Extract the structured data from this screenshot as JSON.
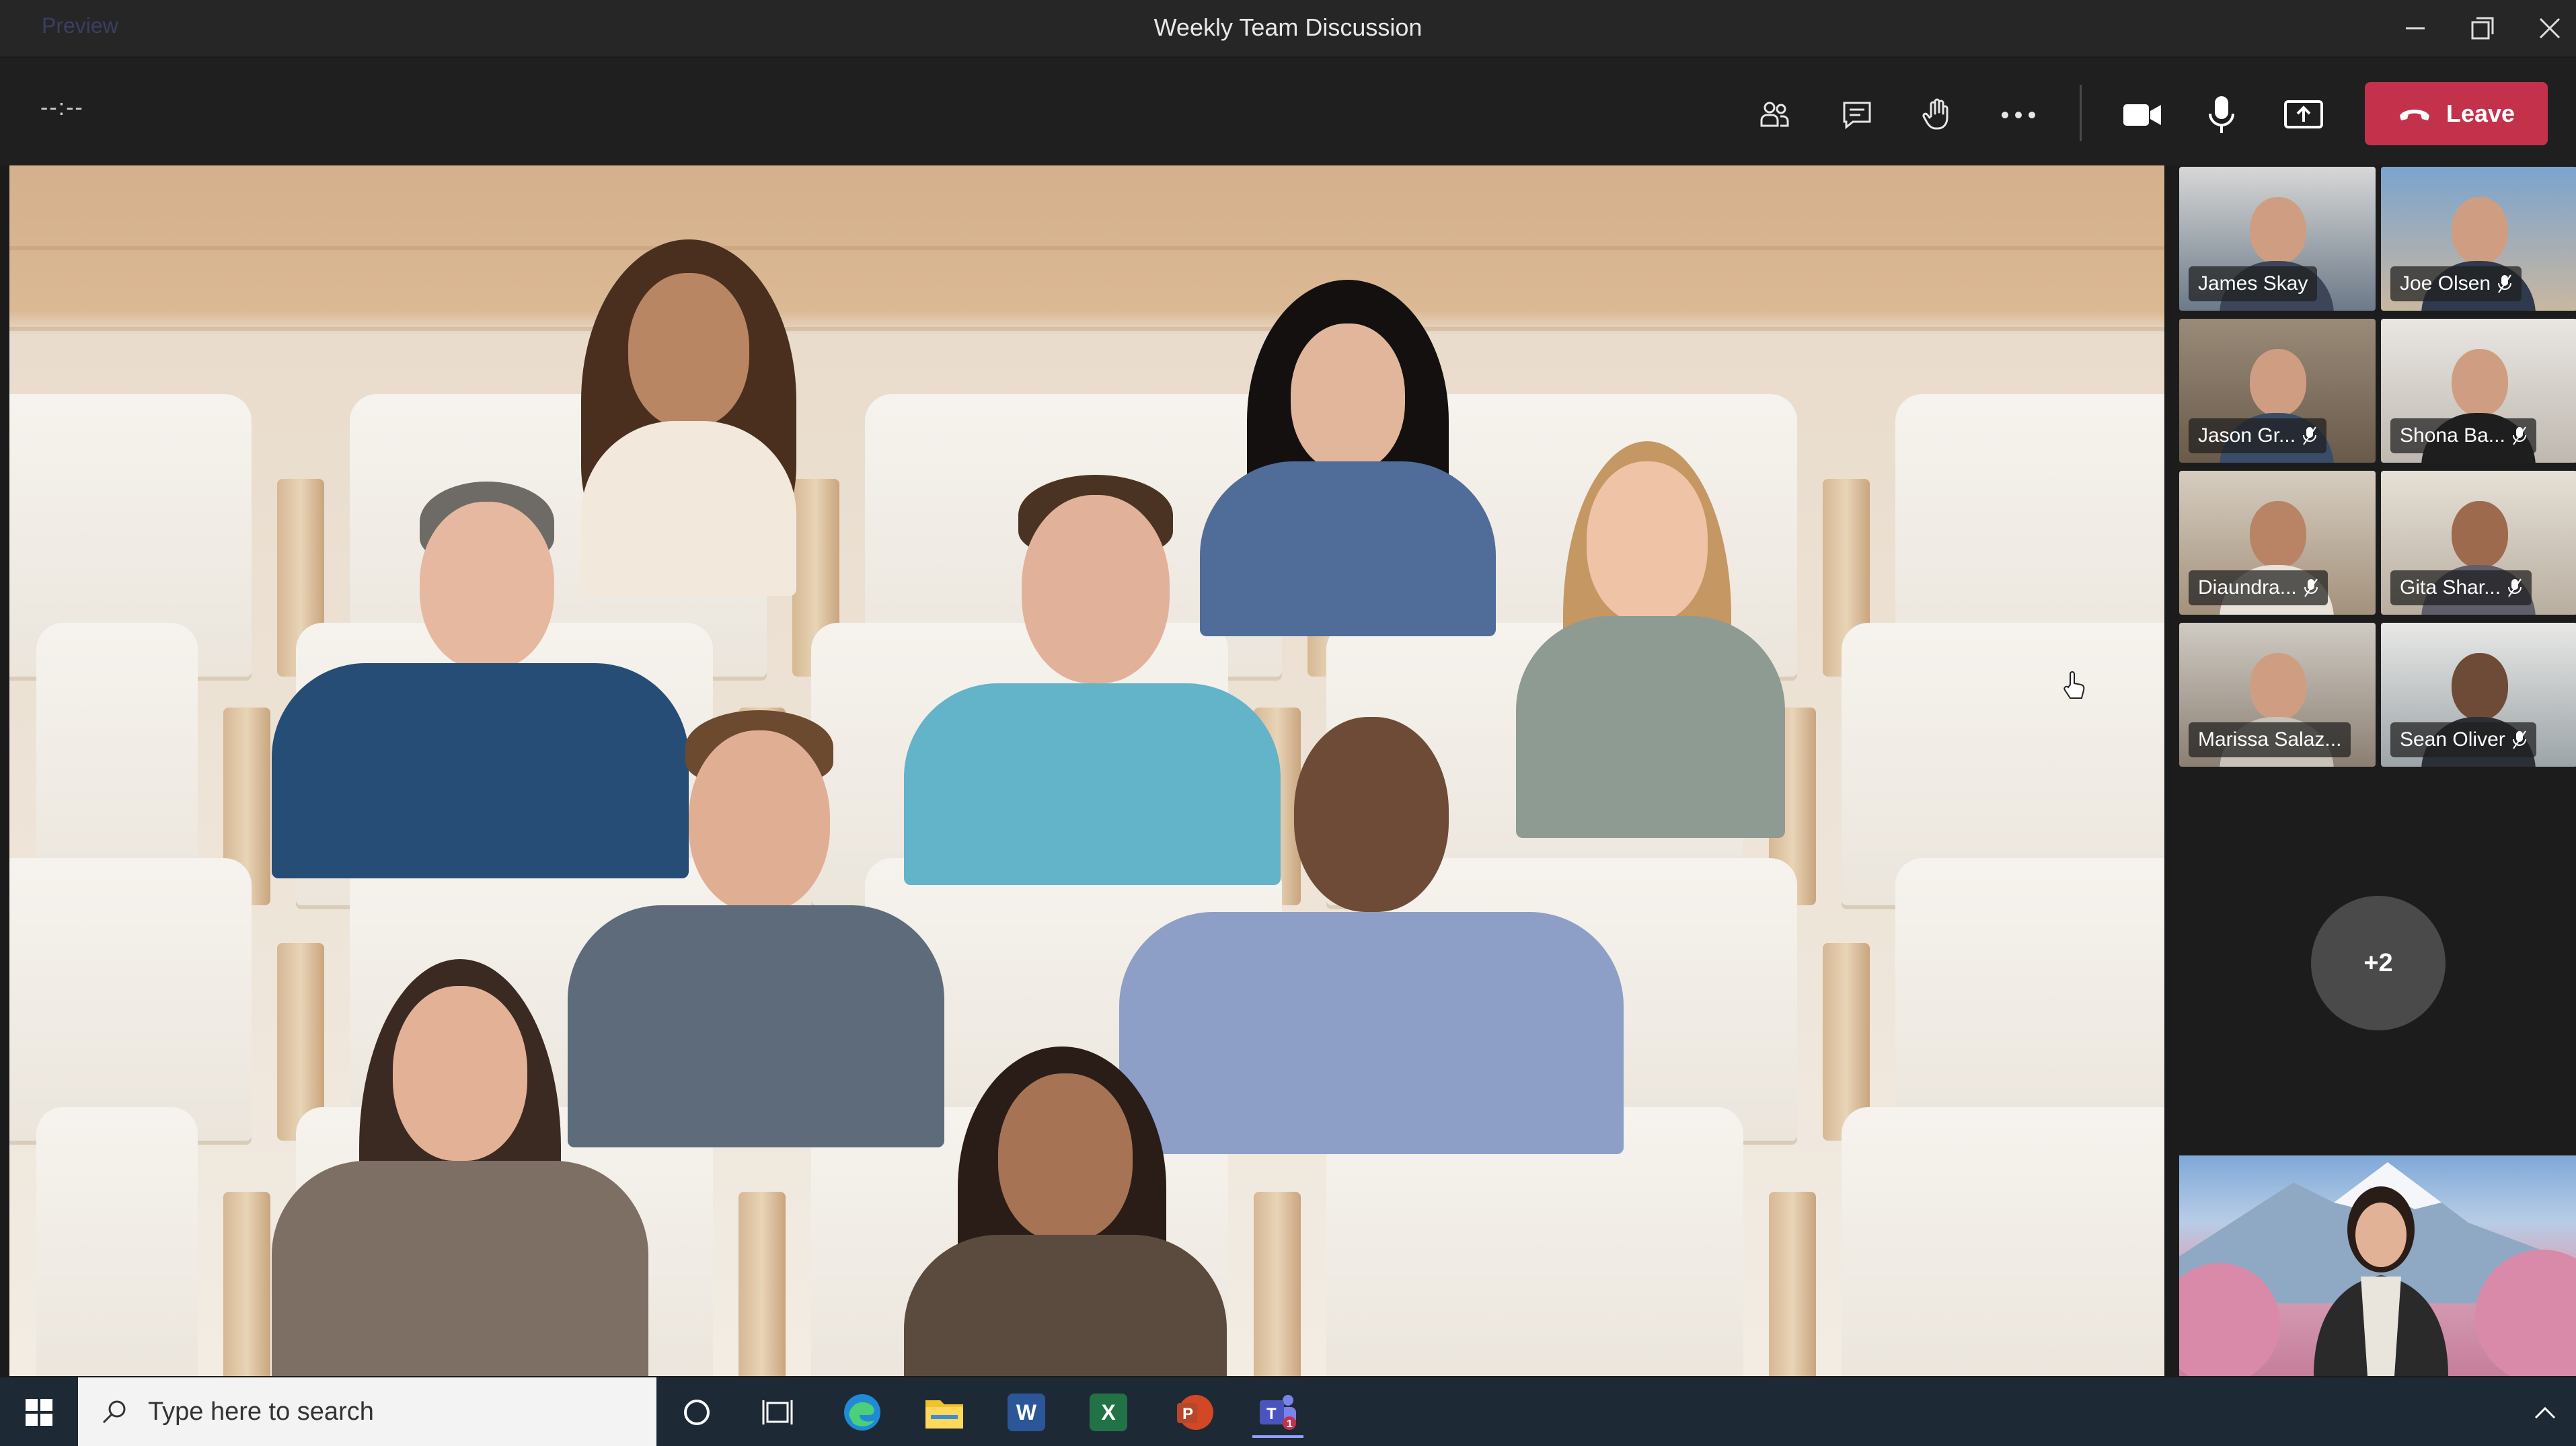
{
  "window": {
    "preview_label": "Preview",
    "title": "Weekly Team Discussion"
  },
  "toolbar": {
    "timer": "--:--",
    "leave_label": "Leave"
  },
  "participants": [
    {
      "name": "James Skay",
      "muted": false
    },
    {
      "name": "Joe Olsen",
      "muted": true
    },
    {
      "name": "Jason Gr...",
      "muted": true
    },
    {
      "name": "Shona Ba...",
      "muted": true
    },
    {
      "name": "Diaundra...",
      "muted": true
    },
    {
      "name": "Gita Shar...",
      "muted": true
    },
    {
      "name": "Marissa Salaz...",
      "muted": false
    },
    {
      "name": "Sean Oliver",
      "muted": true
    }
  ],
  "overflow": {
    "label": "+2"
  },
  "taskbar": {
    "search_placeholder": "Type here to search",
    "apps": [
      "edge-icon",
      "file-explorer-icon",
      "word-icon",
      "excel-icon",
      "powerpoint-icon",
      "teams-icon"
    ]
  },
  "colors": {
    "leave": "#c4314b",
    "taskbar": "#1d2a36",
    "titlebar": "#262626"
  }
}
